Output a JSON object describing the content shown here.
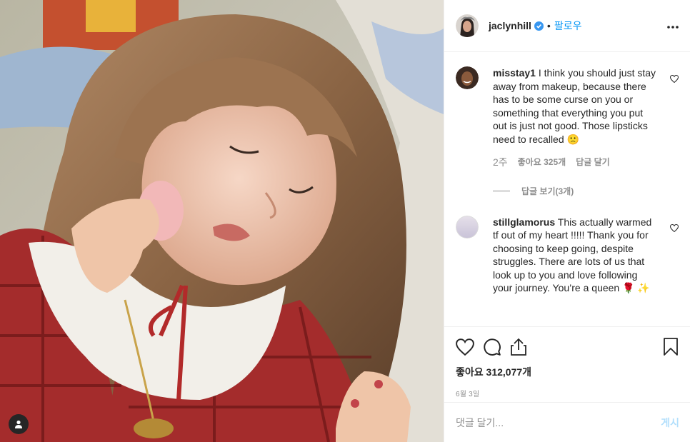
{
  "header": {
    "username": "jaclynhill",
    "separator": "•",
    "follow_label": "팔로우"
  },
  "comments": [
    {
      "username": "misstay1",
      "text": "I think you should just stay away from makeup, because there has to be some curse on you or something that everything you put out is just not good. Those lipsticks need to recalled 🙁",
      "time": "2주",
      "likes": "좋아요 325개",
      "reply_label": "답글 달기",
      "view_replies": "답글 보기(3개)"
    },
    {
      "username": "stillglamorus",
      "text": "This actually warmed tf out of my heart !!!!! Thank you for choosing to keep going, despite struggles. There are lots of us that look up to you and love following your journey. You’re a queen 🌹 ✨"
    }
  ],
  "post": {
    "likes": "좋아요 312,077개",
    "date": "6월 3일"
  },
  "add_comment": {
    "placeholder": "댓글 달기...",
    "post_label": "게시"
  },
  "icons": {
    "like": "heart-icon",
    "comment": "comment-icon",
    "share": "share-icon",
    "save": "bookmark-icon",
    "more": "more-options-icon",
    "verified": "verified-badge-icon",
    "tag": "user-tag-icon"
  },
  "colors": {
    "link": "#0095f6",
    "muted": "#8e8e8e",
    "text": "#262626",
    "post_disabled": "#b2dffc"
  }
}
